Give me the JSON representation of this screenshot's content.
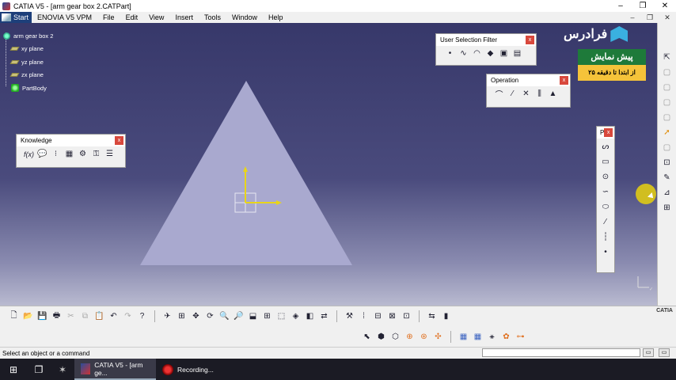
{
  "window": {
    "title": "CATIA V5 - [arm gear box 2.CATPart]",
    "controls": [
      "–",
      "❐",
      "✕"
    ]
  },
  "menu": {
    "start": "Start",
    "items": [
      "ENOVIA V5 VPM",
      "File",
      "Edit",
      "View",
      "Insert",
      "Tools",
      "Window",
      "Help"
    ],
    "right_controls": [
      "–",
      "❐",
      "✕"
    ]
  },
  "tree": {
    "root": "arm gear box 2",
    "children": [
      "xy plane",
      "yz plane",
      "zx plane",
      "PartBody"
    ]
  },
  "panels": {
    "user_selection_filter": {
      "title": "User Selection Filter",
      "close": "x"
    },
    "operation": {
      "title": "Operation",
      "close": "x"
    },
    "knowledge": {
      "title": "Knowledge",
      "close": "x"
    },
    "profile": {
      "title": "P",
      "close": "x"
    }
  },
  "watermark": {
    "brand": "فرادرس",
    "badge_top": "پیش نمایش",
    "badge_bottom": "از ابتدا تا دقیقه ۲۵"
  },
  "status": {
    "message": "Select an object or a command"
  },
  "catia_logo": "CATIA",
  "taskbar": {
    "apps": [
      {
        "label": "CATIA V5 - [arm ge...",
        "active": true
      },
      {
        "label": "Recording...",
        "active": false
      }
    ]
  },
  "colors": {
    "viewport_top": "#37386a",
    "viewport_bottom": "#b9bad0",
    "sketch_fill": "#a9a9cf",
    "axis_yellow": "#e8d51a",
    "close_red": "#d8483c"
  }
}
